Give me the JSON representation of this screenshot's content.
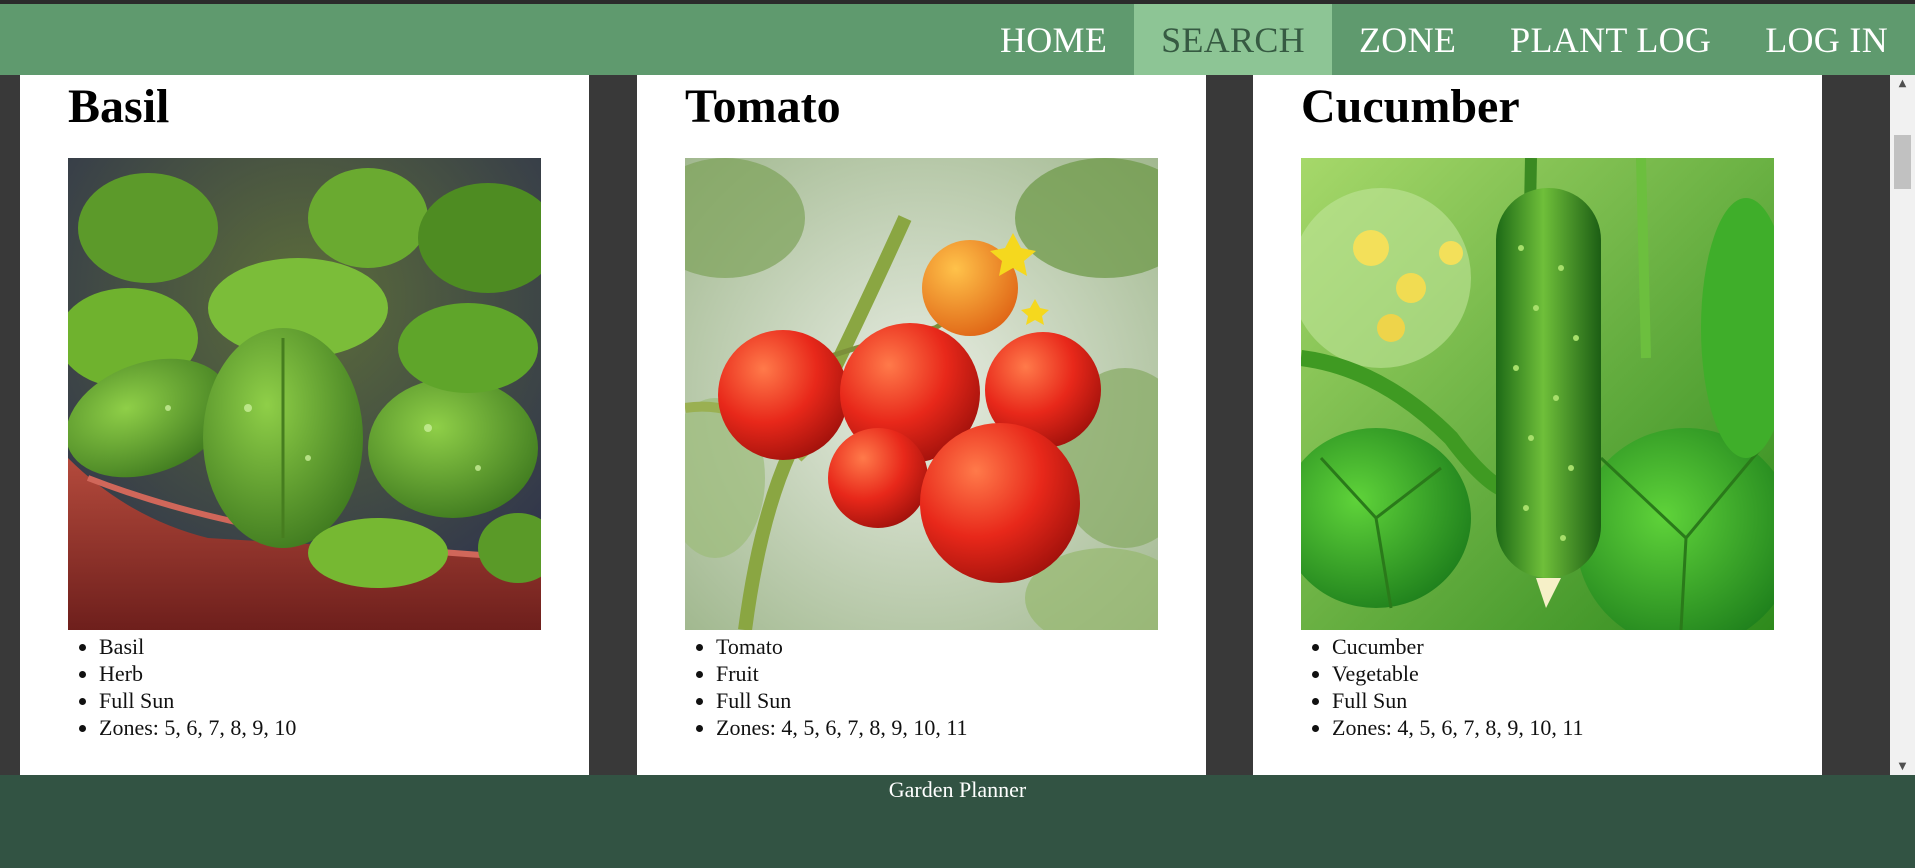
{
  "nav": {
    "items": [
      {
        "label": "HOME",
        "active": false
      },
      {
        "label": "SEARCH",
        "active": true
      },
      {
        "label": "ZONE",
        "active": false
      },
      {
        "label": "PLANT LOG",
        "active": false
      },
      {
        "label": "LOG IN",
        "active": false
      }
    ]
  },
  "plants": [
    {
      "title": "Basil",
      "image_icon": "basil-photo",
      "details": [
        "Basil",
        "Herb",
        "Full Sun",
        "Zones: 5, 6, 7, 8, 9, 10"
      ]
    },
    {
      "title": "Tomato",
      "image_icon": "tomato-photo",
      "details": [
        "Tomato",
        "Fruit",
        "Full Sun",
        "Zones: 4, 5, 6, 7, 8, 9, 10, 11"
      ]
    },
    {
      "title": "Cucumber",
      "image_icon": "cucumber-photo",
      "details": [
        "Cucumber",
        "Vegetable",
        "Full Sun",
        "Zones: 4, 5, 6, 7, 8, 9, 10, 11"
      ]
    }
  ],
  "footer": {
    "text": "Garden Planner"
  },
  "colors": {
    "nav_bg": "#5f9a6e",
    "nav_active_bg": "#8dc595",
    "page_bg": "#393939",
    "footer_bg": "#325343"
  }
}
